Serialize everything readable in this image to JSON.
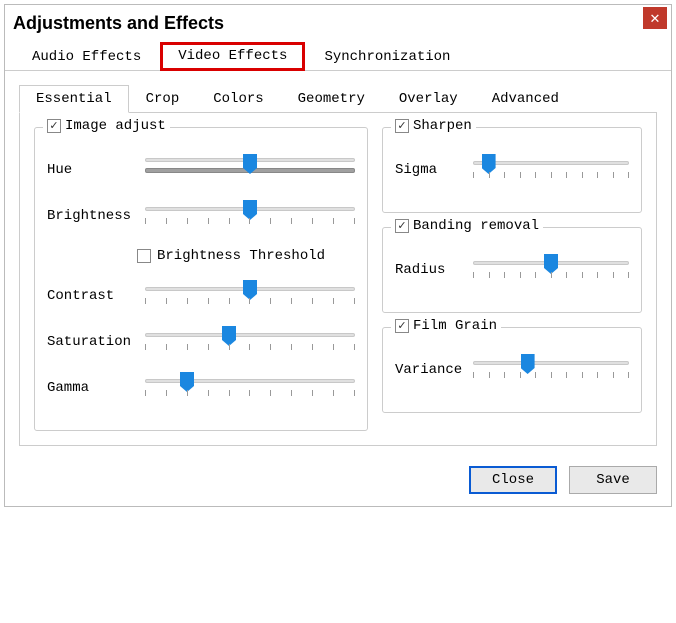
{
  "title": "Adjustments and Effects",
  "main_tabs": {
    "audio": "Audio Effects",
    "video": "Video Effects",
    "sync": "Synchronization"
  },
  "sub_tabs": {
    "essential": "Essential",
    "crop": "Crop",
    "colors": "Colors",
    "geometry": "Geometry",
    "overlay": "Overlay",
    "advanced": "Advanced"
  },
  "image_adjust": {
    "title": "Image adjust",
    "hue": "Hue",
    "brightness": "Brightness",
    "brightness_threshold": "Brightness Threshold",
    "contrast": "Contrast",
    "saturation": "Saturation",
    "gamma": "Gamma"
  },
  "sharpen": {
    "title": "Sharpen",
    "sigma": "Sigma"
  },
  "banding": {
    "title": "Banding removal",
    "radius": "Radius"
  },
  "film_grain": {
    "title": "Film Grain",
    "variance": "Variance"
  },
  "buttons": {
    "close": "Close",
    "save": "Save"
  },
  "chart_data": {
    "type": "table",
    "title": "Slider positions (0–100, left to right)",
    "rows": [
      {
        "group": "Image adjust",
        "control": "Hue",
        "value": 50
      },
      {
        "group": "Image adjust",
        "control": "Brightness",
        "value": 50
      },
      {
        "group": "Image adjust",
        "control": "Brightness Threshold",
        "checked": false
      },
      {
        "group": "Image adjust",
        "control": "Contrast",
        "value": 50
      },
      {
        "group": "Image adjust",
        "control": "Saturation",
        "value": 40
      },
      {
        "group": "Image adjust",
        "control": "Gamma",
        "value": 20
      },
      {
        "group": "Sharpen",
        "control": "Sigma",
        "value": 10
      },
      {
        "group": "Banding removal",
        "control": "Radius",
        "value": 50
      },
      {
        "group": "Film Grain",
        "control": "Variance",
        "value": 35
      }
    ]
  }
}
